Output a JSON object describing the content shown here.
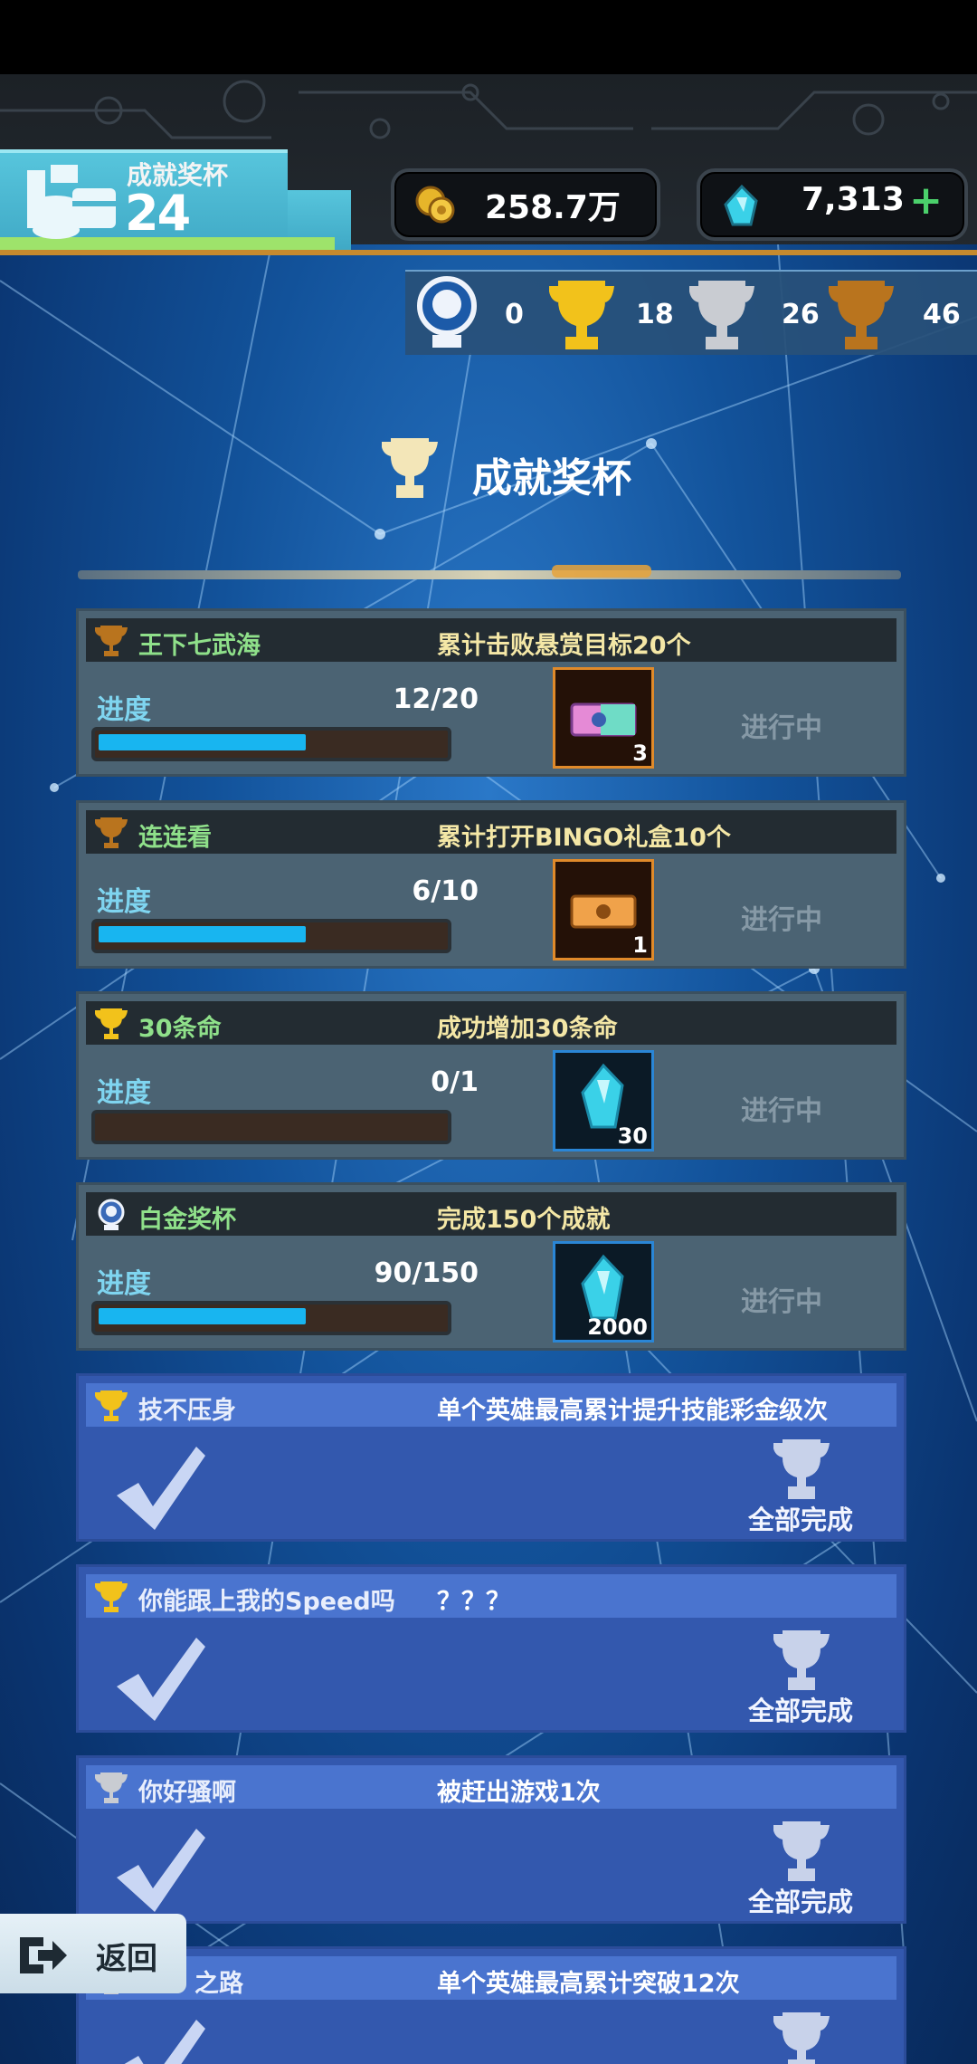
{
  "header": {
    "title": "成就奖杯",
    "count": "24",
    "coins": "258.7万",
    "gems": "7,313",
    "plus_label": "+"
  },
  "trophy_counts": [
    {
      "type": "platinum",
      "count": "0"
    },
    {
      "type": "gold",
      "count": "18"
    },
    {
      "type": "silver",
      "count": "26"
    },
    {
      "type": "bronze",
      "count": "46"
    }
  ],
  "section": {
    "title": "成就奖杯"
  },
  "progress_label": "进度",
  "achievements": [
    {
      "trophy": "bronze",
      "name": "王下七武海",
      "desc": "累计击败悬赏目标20个",
      "progress": "12/20",
      "fraction": 0.6,
      "reward": "ticket-pink",
      "reward_count": "3",
      "status": "进行中"
    },
    {
      "trophy": "bronze",
      "name": "连连看",
      "desc": "累计打开BINGO礼盒10个",
      "progress": "6/10",
      "fraction": 0.6,
      "reward": "ticket-orange",
      "reward_count": "1",
      "status": "进行中"
    },
    {
      "trophy": "gold",
      "name": "30条命",
      "desc": "成功增加30条命",
      "progress": "0/1",
      "fraction": 0,
      "reward": "gem",
      "reward_count": "30",
      "status": "进行中"
    },
    {
      "trophy": "platinum",
      "name": "白金奖杯",
      "desc": "完成150个成就",
      "progress": "90/150",
      "fraction": 0.6,
      "reward": "gem",
      "reward_count": "2000",
      "status": "进行中"
    }
  ],
  "completed": [
    {
      "trophy": "gold",
      "name": "技不压身",
      "desc": "单个英雄最高累计提升技能彩金级次",
      "label": "全部完成"
    },
    {
      "trophy": "gold",
      "name": "你能跟上我的Speed吗",
      "desc": "？？？",
      "label": "全部完成"
    },
    {
      "trophy": "silver",
      "name": "你好骚啊",
      "desc": "被赶出游戏1次",
      "label": "全部完成"
    },
    {
      "trophy": "silver",
      "name": "之路",
      "desc": "单个英雄最高累计突破12次",
      "label": ""
    }
  ],
  "back_label": "返回",
  "colors": {
    "gold": "#f2c21b",
    "silver": "#c9ccd2",
    "bronze": "#b9741e",
    "platinum": "#dfe6f3",
    "progress_fill": "#18b5f0"
  }
}
